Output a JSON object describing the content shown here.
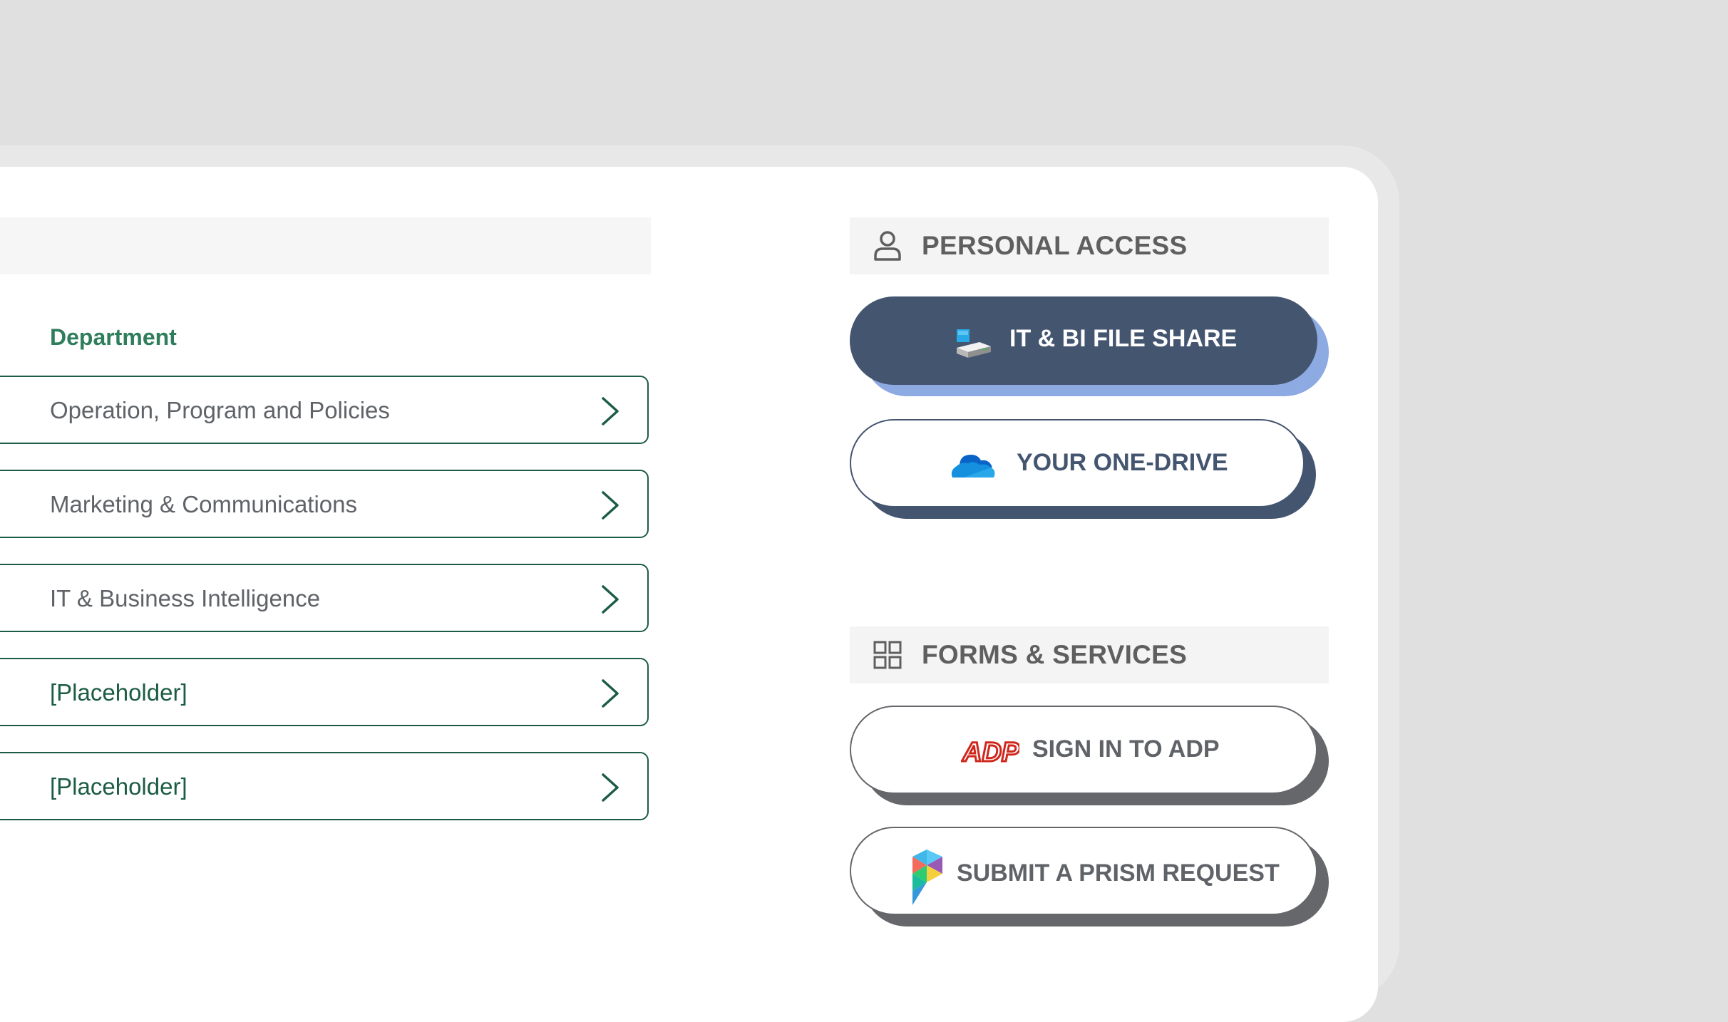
{
  "departments": {
    "heading": "Department",
    "items": [
      {
        "label": "Operation, Program and Policies"
      },
      {
        "label": "Marketing & Communications"
      },
      {
        "label": "IT & Business Intelligence"
      },
      {
        "label": "[Placeholder]"
      },
      {
        "label": "[Placeholder]"
      }
    ]
  },
  "personal_access": {
    "title": "PERSONAL ACCESS",
    "icon": "user-icon",
    "buttons": [
      {
        "label": "IT & BI FILE SHARE",
        "icon": "file-share-drive-icon"
      },
      {
        "label": "YOUR ONE-DRIVE",
        "icon": "onedrive-cloud-icon"
      }
    ]
  },
  "forms_services": {
    "title": "FORMS & SERVICES",
    "icon": "grid-icon",
    "buttons": [
      {
        "label": "SIGN IN TO ADP",
        "icon": "adp-logo",
        "logo_text": "ADP"
      },
      {
        "label": "SUBMIT A PRISM REQUEST",
        "icon": "prism-logo"
      }
    ]
  },
  "colors": {
    "accent_green": "#1c5c44",
    "dept_heading_green": "#2e7d5b",
    "navy": "#445570",
    "light_blue_shadow": "#8eaae3",
    "gray_shadow": "#65676b",
    "adp_red": "#d0271d"
  }
}
